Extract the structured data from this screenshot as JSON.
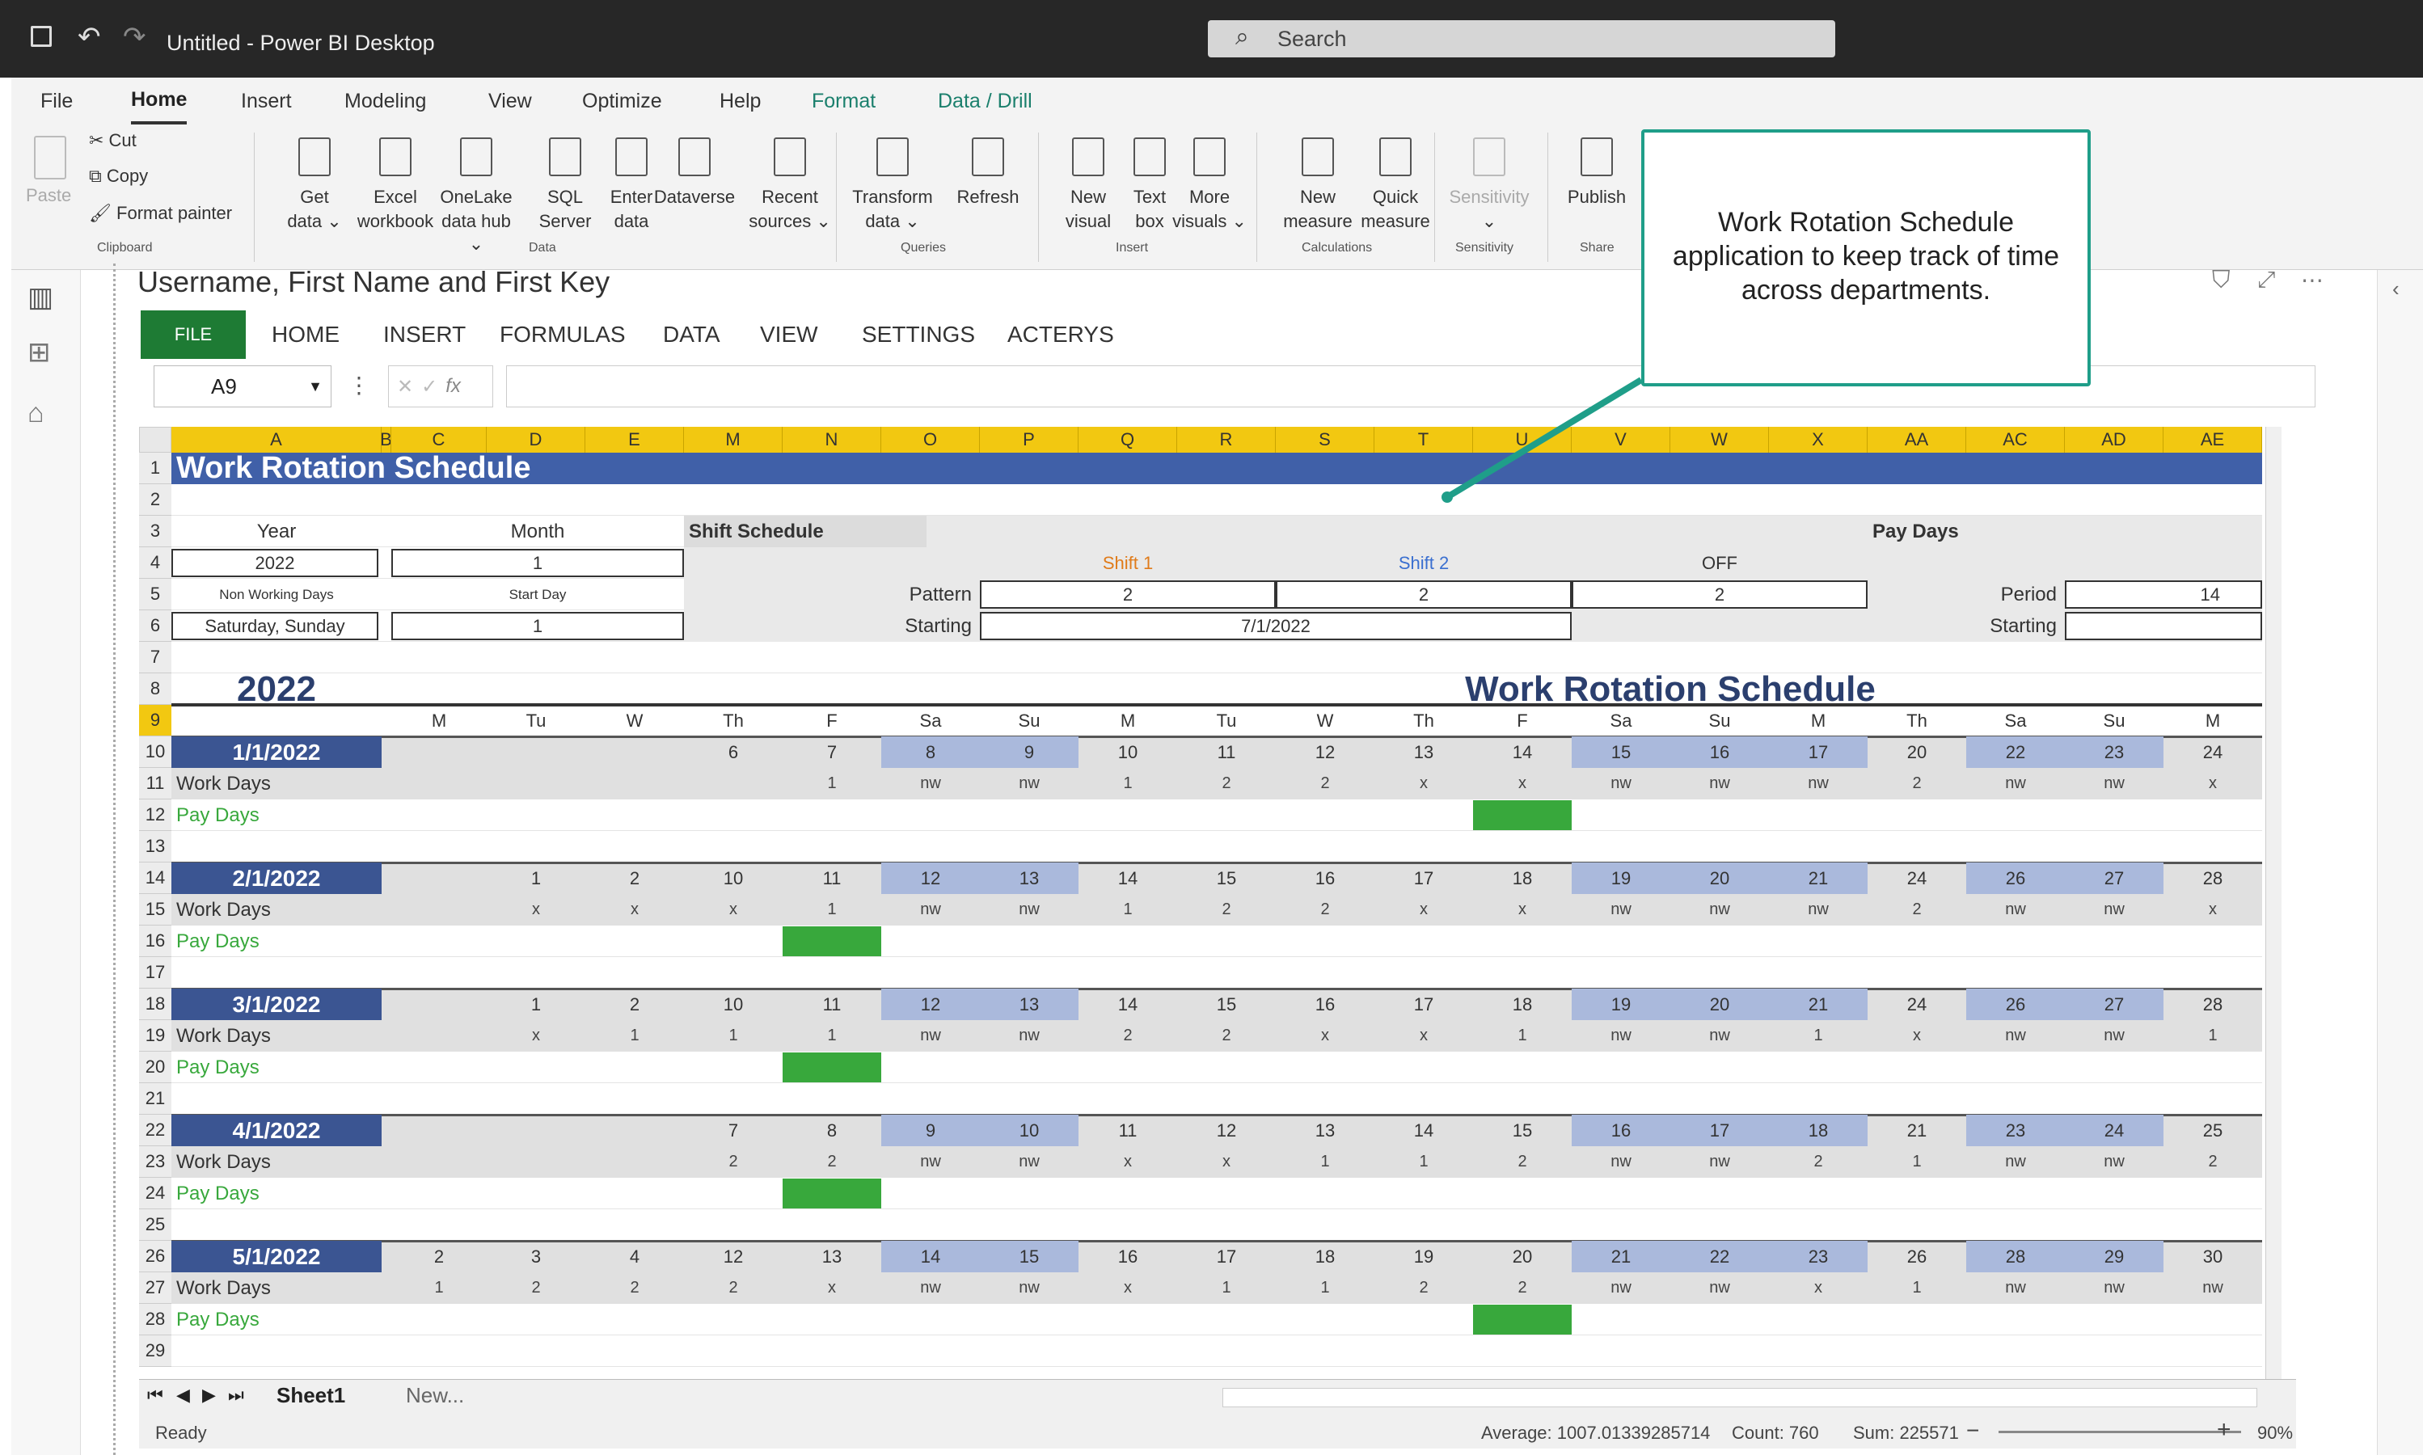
{
  "app": {
    "title": "Untitled - Power BI Desktop",
    "search_placeholder": "Search"
  },
  "menu": {
    "items": [
      "File",
      "Home",
      "Insert",
      "Modeling",
      "View",
      "Optimize",
      "Help",
      "Format",
      "Data / Drill"
    ],
    "active": "Home"
  },
  "ribbon": {
    "clipboard": {
      "paste": "Paste",
      "cut": "Cut",
      "copy": "Copy",
      "format_painter": "Format painter",
      "group": "Clipboard"
    },
    "data": {
      "items": [
        [
          "Get",
          "data ⌄"
        ],
        [
          "Excel",
          "workbook"
        ],
        [
          "OneLake",
          "data hub ⌄"
        ],
        [
          "SQL",
          "Server"
        ],
        [
          "Enter",
          "data"
        ],
        [
          "Dataverse",
          ""
        ],
        [
          "Recent",
          "sources ⌄"
        ]
      ],
      "group": "Data"
    },
    "queries": {
      "items": [
        [
          "Transform",
          "data ⌄"
        ],
        [
          "Refresh",
          ""
        ]
      ],
      "group": "Queries"
    },
    "insert": {
      "items": [
        [
          "New",
          "visual"
        ],
        [
          "Text",
          "box"
        ],
        [
          "More",
          "visuals ⌄"
        ]
      ],
      "group": "Insert"
    },
    "calculations": {
      "items": [
        [
          "New",
          "measure"
        ],
        [
          "Quick",
          "measure"
        ]
      ],
      "group": "Calculations"
    },
    "sensitivity": {
      "items": [
        [
          "Sensitivity",
          "⌄"
        ]
      ],
      "group": "Sensitivity"
    },
    "share": {
      "items": [
        [
          "Publish",
          ""
        ]
      ],
      "group": "Share"
    }
  },
  "visual": {
    "title": "Username, First Name and First Key"
  },
  "workbook_tabs": {
    "file": "FILE",
    "items": [
      "HOME",
      "INSERT",
      "FORMULAS",
      "DATA",
      "VIEW",
      "SETTINGS",
      "ACTERYS"
    ]
  },
  "formula_bar": {
    "name_box": "A9",
    "fx": "fx",
    "cancel": "✕",
    "confirm": "✓",
    "value": ""
  },
  "columns": [
    "A",
    "B",
    "C",
    "D",
    "E",
    "M",
    "N",
    "O",
    "P",
    "Q",
    "R",
    "S",
    "T",
    "U",
    "V",
    "W",
    "X",
    "AA",
    "AC",
    "AD",
    "AE"
  ],
  "sheet": {
    "title": "Work Rotation Schedule",
    "year_label": "Year",
    "year_value": "2022",
    "month_label": "Month",
    "month_value": "1",
    "nonworking_label": "Non Working Days",
    "nonworking_value": "Saturday, Sunday",
    "startday_label": "Start Day",
    "startday_value": "1",
    "shift_schedule": "Shift Schedule",
    "shift1": "Shift 1",
    "shift2": "Shift 2",
    "off": "OFF",
    "pattern_label": "Pattern",
    "pattern_values": [
      "2",
      "2",
      "2"
    ],
    "starting_label": "Starting",
    "starting_value": "7/1/2022",
    "pay_days": "Pay Days",
    "period_label": "Period",
    "period_value": "14",
    "pay_starting_label": "Starting",
    "pay_starting_value": "",
    "big_year": "2022",
    "big_title": "Work Rotation Schedule",
    "day_headers": [
      "",
      "M",
      "Tu",
      "W",
      "Th",
      "F",
      "Sa",
      "Su",
      "M",
      "Tu",
      "W",
      "Th",
      "F",
      "Sa",
      "Su",
      "M",
      "Th",
      "Sa",
      "Su",
      "M"
    ],
    "work_days_label": "Work Days",
    "pay_days_label": "Pay Days",
    "months": [
      {
        "date": "1/1/2022",
        "days": [
          "",
          "",
          "",
          "",
          "6",
          "7",
          "8",
          "9",
          "10",
          "11",
          "12",
          "13",
          "14",
          "15",
          "16",
          "17",
          "20",
          "22",
          "23",
          "24"
        ],
        "work": [
          "",
          "",
          "",
          "",
          "",
          "1",
          "nw",
          "nw",
          "1",
          "2",
          "2",
          "x",
          "x",
          "nw",
          "nw",
          "nw",
          "2",
          "nw",
          "nw",
          "x"
        ],
        "pay": [
          12
        ]
      },
      {
        "date": "2/1/2022",
        "days": [
          "",
          "",
          "1",
          "2",
          "10",
          "11",
          "12",
          "13",
          "14",
          "15",
          "16",
          "17",
          "18",
          "19",
          "20",
          "21",
          "24",
          "26",
          "27",
          "28"
        ],
        "work": [
          "",
          "",
          "x",
          "x",
          "x",
          "1",
          "nw",
          "nw",
          "1",
          "2",
          "2",
          "x",
          "x",
          "nw",
          "nw",
          "nw",
          "2",
          "nw",
          "nw",
          "x"
        ],
        "pay": [
          5
        ]
      },
      {
        "date": "3/1/2022",
        "days": [
          "",
          "",
          "1",
          "2",
          "10",
          "11",
          "12",
          "13",
          "14",
          "15",
          "16",
          "17",
          "18",
          "19",
          "20",
          "21",
          "24",
          "26",
          "27",
          "28"
        ],
        "work": [
          "",
          "",
          "x",
          "1",
          "1",
          "1",
          "nw",
          "nw",
          "2",
          "2",
          "x",
          "x",
          "1",
          "nw",
          "nw",
          "1",
          "x",
          "nw",
          "nw",
          "1"
        ],
        "pay": [
          5
        ]
      },
      {
        "date": "4/1/2022",
        "days": [
          "",
          "",
          "",
          "",
          "7",
          "8",
          "9",
          "10",
          "11",
          "12",
          "13",
          "14",
          "15",
          "16",
          "17",
          "18",
          "21",
          "23",
          "24",
          "25"
        ],
        "work": [
          "",
          "",
          "",
          "",
          "2",
          "2",
          "nw",
          "nw",
          "x",
          "x",
          "1",
          "1",
          "2",
          "nw",
          "nw",
          "2",
          "1",
          "nw",
          "nw",
          "2"
        ],
        "pay": [
          5
        ]
      },
      {
        "date": "5/1/2022",
        "days": [
          "",
          "2",
          "3",
          "4",
          "12",
          "13",
          "14",
          "15",
          "16",
          "17",
          "18",
          "19",
          "20",
          "21",
          "22",
          "23",
          "26",
          "28",
          "29",
          "30"
        ],
        "work": [
          "",
          "1",
          "2",
          "2",
          "2",
          "x",
          "nw",
          "nw",
          "x",
          "1",
          "1",
          "2",
          "2",
          "nw",
          "nw",
          "x",
          "1",
          "nw",
          "nw",
          "nw"
        ],
        "pay": [
          12
        ]
      }
    ]
  },
  "sheet_tabs": {
    "active": "Sheet1",
    "new": "New..."
  },
  "status": {
    "ready": "Ready",
    "average": "Average: 1007.01339285714",
    "count": "Count: 760",
    "sum": "Sum: 225571",
    "zoom": "90%"
  },
  "callout": {
    "text": "Work Rotation Schedule application to keep track of time across departments."
  },
  "colors": {
    "accent": "#f2c811",
    "header_blue": "#4060a8",
    "date_navy": "#3b5592",
    "weekend": "#aab9dc",
    "pay_green": "#38a83c",
    "teal": "#1f9e89"
  }
}
